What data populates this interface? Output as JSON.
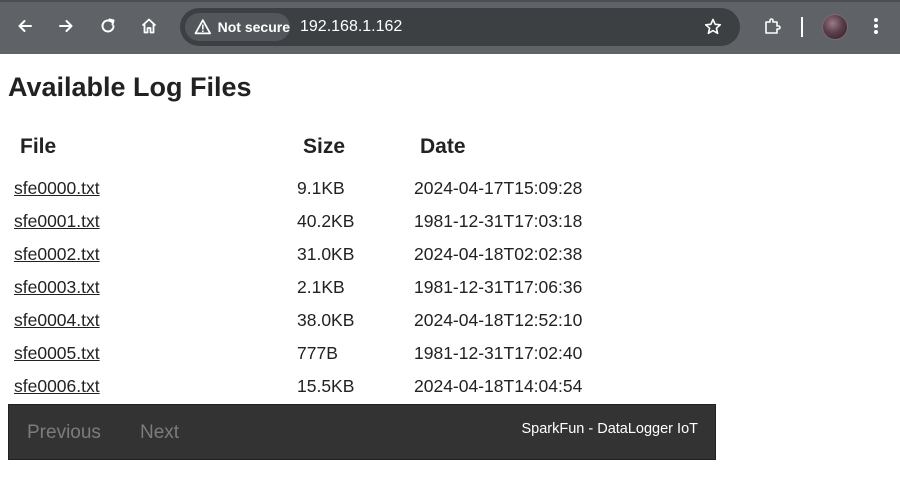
{
  "browser": {
    "security_label": "Not secure",
    "url": "192.168.1.162"
  },
  "page": {
    "title": "Available Log Files",
    "columns": [
      "File",
      "Size",
      "Date"
    ],
    "rows": [
      {
        "file": "sfe0000.txt",
        "size": "9.1KB",
        "date": "2024-04-17T15:09:28"
      },
      {
        "file": "sfe0001.txt",
        "size": "40.2KB",
        "date": "1981-12-31T17:03:18"
      },
      {
        "file": "sfe0002.txt",
        "size": "31.0KB",
        "date": "2024-04-18T02:02:38"
      },
      {
        "file": "sfe0003.txt",
        "size": "2.1KB",
        "date": "1981-12-31T17:06:36"
      },
      {
        "file": "sfe0004.txt",
        "size": "38.0KB",
        "date": "2024-04-18T12:52:10"
      },
      {
        "file": "sfe0005.txt",
        "size": "777B",
        "date": "1981-12-31T17:02:40"
      },
      {
        "file": "sfe0006.txt",
        "size": "15.5KB",
        "date": "2024-04-18T14:04:54"
      }
    ]
  },
  "footer": {
    "previous_label": "Previous",
    "next_label": "Next",
    "brand": "SparkFun - DataLogger IoT"
  },
  "colors": {
    "chrome_bg": "#5f6368",
    "omnibox_bg": "#3c4043",
    "footer_bg": "#333333",
    "text": "#222222",
    "disabled_pager": "#7c7c7c"
  }
}
